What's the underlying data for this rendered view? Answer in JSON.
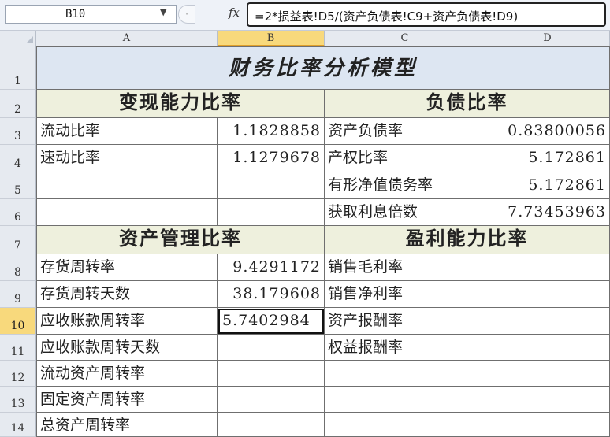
{
  "formula_bar": {
    "name_box": "B10",
    "fx_label": "fx",
    "formula": "=2*损益表!D5/(资产负债表!C9+资产负债表!D9)"
  },
  "columns": [
    "A",
    "B",
    "C",
    "D"
  ],
  "selected_column": "B",
  "rows": [
    "1",
    "2",
    "3",
    "4",
    "5",
    "6",
    "7",
    "8",
    "9",
    "10",
    "11",
    "12",
    "13",
    "14"
  ],
  "selected_row": "10",
  "sheet": {
    "title": "财务比率分析模型",
    "sections": {
      "liquidity": "变现能力比率",
      "debt": "负债比率",
      "asset_mgmt": "资产管理比率",
      "profitability": "盈利能力比率"
    },
    "cells": {
      "A3": "流动比率",
      "B3": "1.1828858",
      "C3": "资产负债率",
      "D3": "0.83800056",
      "A4": "速动比率",
      "B4": "1.1279678",
      "C4": "产权比率",
      "D4": "5.172861",
      "C5": "有形净值债务率",
      "D5": "5.172861",
      "C6": "获取利息倍数",
      "D6": "7.73453963",
      "A8": "存货周转率",
      "B8": "9.4291172",
      "C8": "销售毛利率",
      "A9": "存货周转天数",
      "B9": "38.179608",
      "C9": "销售净利率",
      "A10": "应收账款周转率",
      "B10": "5.7402984",
      "C10": "资产报酬率",
      "A11": "应收账款周转天数",
      "C11": "权益报酬率",
      "A12": "流动资产周转率",
      "A13": "固定资产周转率",
      "A14": "总资产周转率"
    }
  }
}
